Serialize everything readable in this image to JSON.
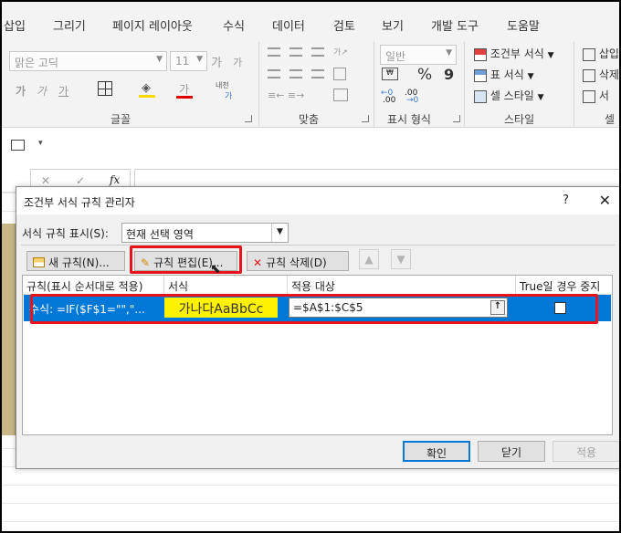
{
  "ribbon": {
    "tabs": [
      "삽입",
      "그리기",
      "페이지 레이아웃",
      "수식",
      "데이터",
      "검토",
      "보기",
      "개발 도구",
      "도움말"
    ],
    "font_name": "맑은 고딕",
    "font_size": "11",
    "grow_font": "가",
    "shrink_font": "가",
    "bold": "가",
    "italic": "가",
    "underline": "가",
    "font_color": "가",
    "phonetic": "내천",
    "phonetic_sub": "가",
    "number_format": "일반",
    "percent": "%",
    "comma": "9",
    "inc_decimal": ".00",
    "dec_decimal": ".00",
    "group_font": "글꼴",
    "group_align": "맞춤",
    "group_number": "표시 형식",
    "group_style": "스타일",
    "group_cells": "셀",
    "conditional_format": "조건부 서식",
    "format_as_table": "표 서식",
    "cell_styles": "셀 스타일",
    "insert": "삽입",
    "delete": "삭제",
    "format": "서"
  },
  "formula_bar": {
    "cancel": "✕",
    "enter": "✓",
    "fx": "fx"
  },
  "dialog": {
    "title": "조건부 서식 규칙 관리자",
    "help": "?",
    "close": "✕",
    "show_label": "서식 규칙 표시(S):",
    "show_value": "현재 선택 영역",
    "buttons": {
      "new_rule": "새 규칙(N)...",
      "edit_rule": "규칙 편집(E)...",
      "delete_rule": "규칙 삭제(D)"
    },
    "columns": [
      "규칙(표시 순서대로 적용)",
      "서식",
      "적용 대상",
      "True일 경우 중지"
    ],
    "rule": {
      "condition": "수식: =IF($F$1=\"\",\"...",
      "preview": "가나다AaBbCc",
      "applies_to": "=$A$1:$C$5",
      "stop_if_true": false
    },
    "ok": "확인",
    "close_btn": "닫기",
    "apply": "적용"
  },
  "colors": {
    "selection": "#0078d7",
    "preview_fill": "#fff200",
    "highlight": "#e8141c"
  }
}
